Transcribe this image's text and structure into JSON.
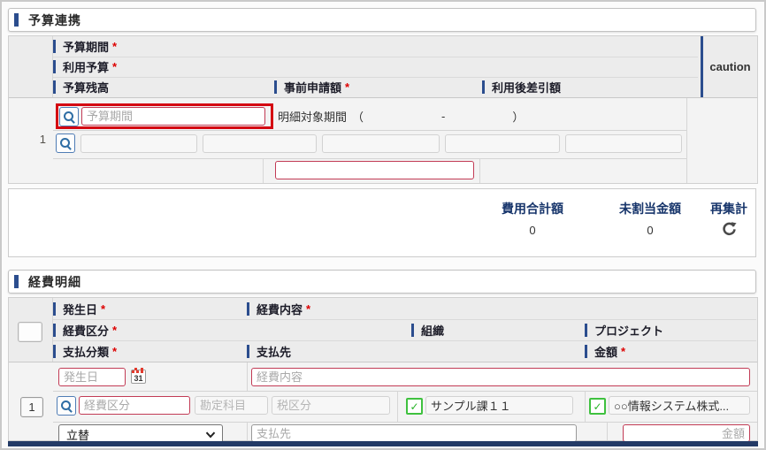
{
  "colors": {
    "accent_navy": "#2b4d8e",
    "highlight_red": "#d40511",
    "error_border": "#c23b55",
    "check_green": "#3fc13f",
    "summary_navy": "#17356b",
    "bottom_bar_navy": "#233a66"
  },
  "icons": {
    "check": "✓",
    "search": "magnifier",
    "calendar": "calendar-31",
    "refresh": "circular-arrow"
  },
  "budget": {
    "title": "予算連携",
    "col_budget_period": "予算期間",
    "col_usage_budget": "利用予算",
    "col_budget_balance": "予算残高",
    "col_advance_request": "事前申請額",
    "col_after_use_balance": "利用後差引額",
    "col_caution": "caution",
    "row_number": "1",
    "budget_period_placeholder": "予算期間",
    "detail_period_label": "明細対象期間",
    "detail_period_open": "（",
    "detail_period_dash": "-",
    "detail_period_close": "）"
  },
  "summary": {
    "total_label": "費用合計額",
    "total_value": "0",
    "unallocated_label": "未割当金額",
    "unallocated_value": "0",
    "recalc_label": "再集計"
  },
  "expense": {
    "title": "経費明細",
    "col_occurrence_date": "発生日",
    "col_expense_content": "経費内容",
    "col_expense_category": "経費区分",
    "col_organization": "組織",
    "col_project": "プロジェクト",
    "col_payment_class": "支払分類",
    "col_payee": "支払先",
    "col_amount": "金額",
    "row_number": "1",
    "occurrence_date_placeholder": "発生日",
    "calendar_day": "31",
    "expense_content_placeholder": "経費内容",
    "expense_category_placeholder": "経費区分",
    "account_title_placeholder": "勘定科目",
    "tax_class_placeholder": "税区分",
    "organization_value": "サンプル課１１",
    "project_value": "○○情報システム株式...",
    "payment_type_value": "立替",
    "payee_placeholder": "支払先",
    "amount_placeholder": "金額"
  },
  "marks": {
    "required": "*"
  }
}
